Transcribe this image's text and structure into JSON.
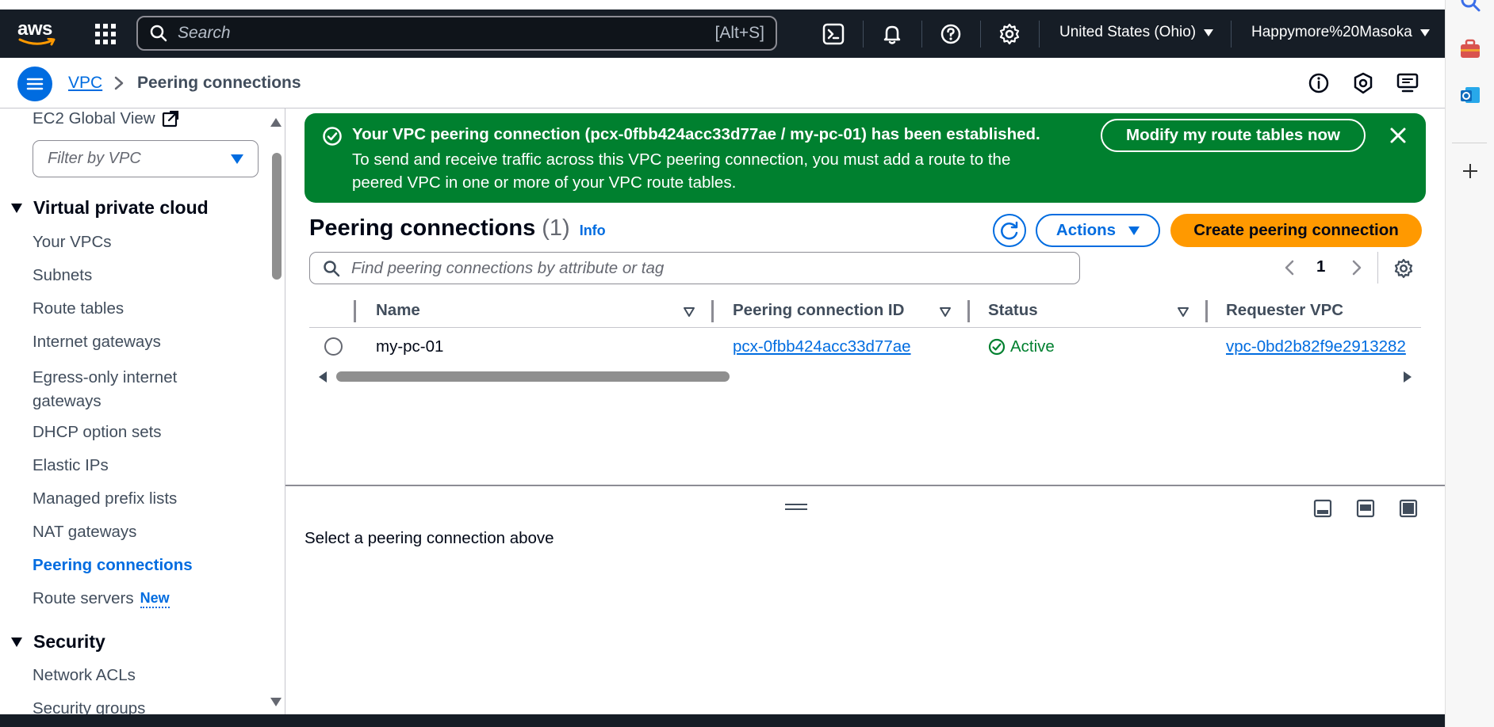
{
  "topnav": {
    "logo": "aws",
    "search_placeholder": "Search",
    "search_shortcut": "[Alt+S]",
    "region": "United States (Ohio)",
    "account": "Happymore%20Masoka"
  },
  "breadcrumb": {
    "parent": "VPC",
    "current": "Peering connections"
  },
  "sidebar": {
    "ec2_global_view": "EC2 Global View",
    "filter_placeholder": "Filter by VPC",
    "sections": [
      {
        "title": "Virtual private cloud",
        "items": [
          {
            "label": "Your VPCs"
          },
          {
            "label": "Subnets"
          },
          {
            "label": "Route tables"
          },
          {
            "label": "Internet gateways"
          },
          {
            "label": "Egress-only internet gateways"
          },
          {
            "label": "DHCP option sets"
          },
          {
            "label": "Elastic IPs"
          },
          {
            "label": "Managed prefix lists"
          },
          {
            "label": "NAT gateways"
          },
          {
            "label": "Peering connections",
            "active": true
          },
          {
            "label": "Route servers",
            "badge": "New"
          }
        ]
      },
      {
        "title": "Security",
        "items": [
          {
            "label": "Network ACLs"
          },
          {
            "label": "Security groups"
          }
        ]
      }
    ]
  },
  "flash": {
    "title": "Your VPC peering connection (pcx-0fbb424acc33d77ae / my-pc-01) has been established.",
    "body": "To send and receive traffic across this VPC peering connection, you must add a route to the peered VPC in one or more of your VPC route tables.",
    "action": "Modify my route tables now",
    "color": "#00802f"
  },
  "table": {
    "title": "Peering connections",
    "count": "(1)",
    "info": "Info",
    "actions_label": "Actions",
    "create_label": "Create peering connection",
    "search_placeholder": "Find peering connections by attribute or tag",
    "page": "1",
    "columns": [
      "Name",
      "Peering connection ID",
      "Status",
      "Requester VPC"
    ],
    "rows": [
      {
        "name": "my-pc-01",
        "peering_id": "pcx-0fbb424acc33d77ae",
        "status": "Active",
        "requester_vpc": "vpc-0bd2b82f9e2913282"
      }
    ]
  },
  "split_panel": {
    "empty_text": "Select a peering connection above"
  },
  "colors": {
    "accent": "#006ce0",
    "primary_button": "#ff9900",
    "success": "#00802f",
    "nav_bg": "#161d26"
  }
}
